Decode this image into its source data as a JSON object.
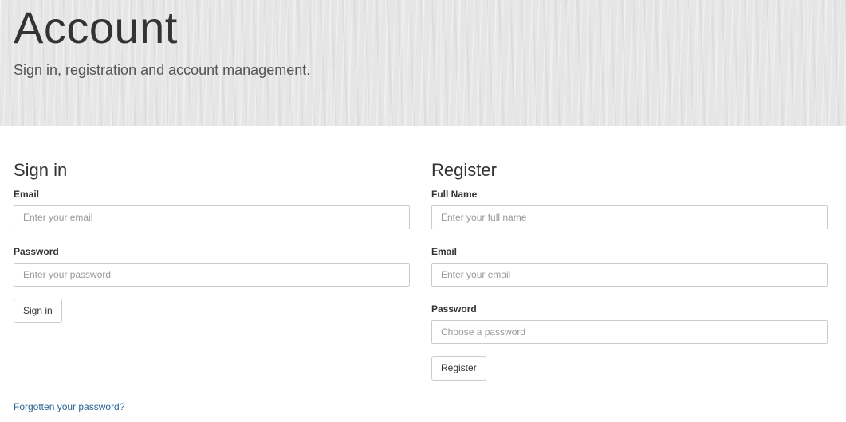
{
  "hero": {
    "title": "Account",
    "subtitle": "Sign in, registration and account management."
  },
  "signin": {
    "heading": "Sign in",
    "email_label": "Email",
    "email_placeholder": "Enter your email",
    "password_label": "Password",
    "password_placeholder": "Enter your password",
    "button_label": "Sign in"
  },
  "register": {
    "heading": "Register",
    "fullname_label": "Full Name",
    "fullname_placeholder": "Enter your full name",
    "email_label": "Email",
    "email_placeholder": "Enter your email",
    "password_label": "Password",
    "password_placeholder": "Choose a password",
    "button_label": "Register"
  },
  "footer": {
    "forgot_link": "Forgotten your password?"
  },
  "colors": {
    "link": "#2a6496",
    "hero_bg": "#e6e6e6",
    "input_border": "#cccccc"
  }
}
